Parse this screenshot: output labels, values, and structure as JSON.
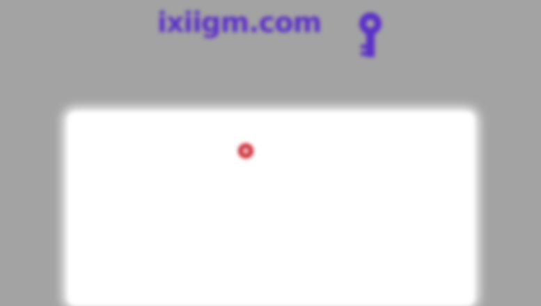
{
  "header": {
    "logo_text": "ixiigm.com",
    "tagline": "",
    "logo_icon": "key-icon"
  },
  "panel": {
    "heading": "",
    "badge_icon": "record-icon",
    "badge_label": ""
  },
  "colors": {
    "background": "#a3a3a3",
    "brand": "#5b2fc9",
    "panel": "#ffffff",
    "badge": "#c9242f"
  }
}
